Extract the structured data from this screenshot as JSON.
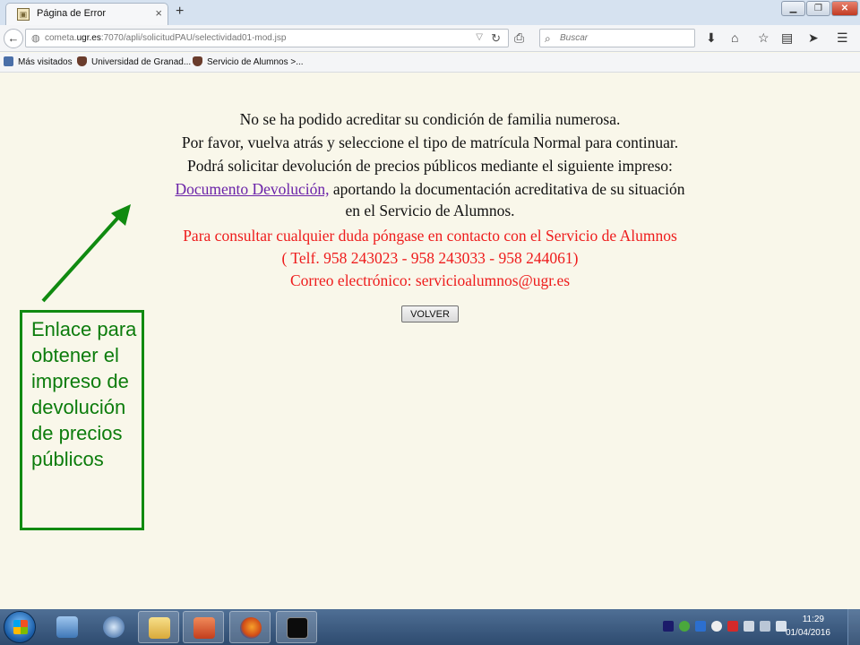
{
  "browser": {
    "tab_title": "Página de Error",
    "tab_close": "×",
    "new_tab": "+",
    "url_prefix": "cometa.",
    "url_host": "ugr.es",
    "url_rest": ":7070/apli/solicitudPAU/selectividad01-mod.jsp",
    "search_placeholder": "Buscar",
    "bookmarks": [
      "Más visitados",
      "Universidad de Granad...",
      "Servicio de Alumnos >..."
    ]
  },
  "page": {
    "line1": "No se ha podido acreditar su condición de familia numerosa.",
    "line2": "Por favor, vuelva atrás y seleccione el tipo de matrícula Normal para continuar.",
    "line3": "Podrá solicitar devolución de precios públicos mediante el siguiente impreso:",
    "link_text": "Documento Devolución,",
    "line4_rest": " aportando la documentación acreditativa de su situación",
    "line5": "en el Servicio de Alumnos.",
    "contact1": "Para consultar cualquier duda póngase en contacto con el Servicio de Alumnos",
    "contact2": "( Telf. 958 243023 - 958 243033 - 958 244061)",
    "contact3": "Correo electrónico: servicioalumnos@ugr.es",
    "volver_label": "VOLVER"
  },
  "annotation": {
    "callout_text": "Enlace para obtener el impreso de devolución de precios públicos",
    "color": "#108a10"
  },
  "taskbar": {
    "time": "11:29",
    "date": "01/04/2016"
  }
}
